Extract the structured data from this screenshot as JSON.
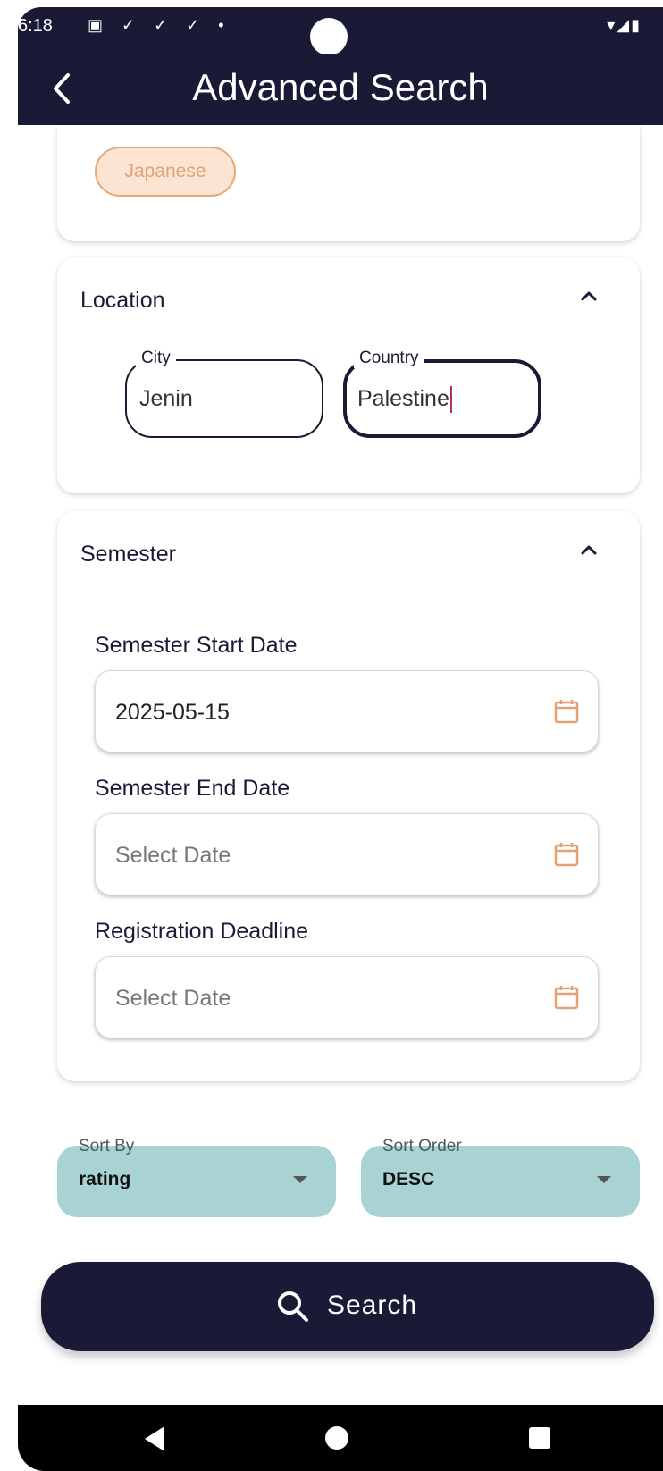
{
  "status_bar": {
    "time": "6:18",
    "left_icons": "▣ ✓ ✓ ✓ •",
    "right_icons": "▾◢▮"
  },
  "app_bar": {
    "title": "Advanced Search",
    "back_icon": "chevron-left-icon"
  },
  "language_section": {
    "chips": [
      "Japanese"
    ]
  },
  "location": {
    "header": "Location",
    "city": {
      "label": "City",
      "value": "Jenin"
    },
    "country": {
      "label": "Country",
      "value": "Palestine"
    }
  },
  "semester": {
    "header": "Semester",
    "start_date": {
      "label": "Semester Start Date",
      "value": "2025-05-15"
    },
    "end_date": {
      "label": "Semester End Date",
      "placeholder": "Select Date"
    },
    "registration_deadline": {
      "label": "Registration Deadline",
      "placeholder": "Select Date"
    }
  },
  "sort": {
    "sort_by": {
      "label": "Sort By",
      "value": "rating"
    },
    "sort_order": {
      "label": "Sort Order",
      "value": "DESC"
    }
  },
  "search_button": {
    "label": "Search"
  },
  "colors": {
    "primary": "#1b1a36",
    "accent": "#e6a877",
    "dropdown": "#a8d3d2"
  }
}
